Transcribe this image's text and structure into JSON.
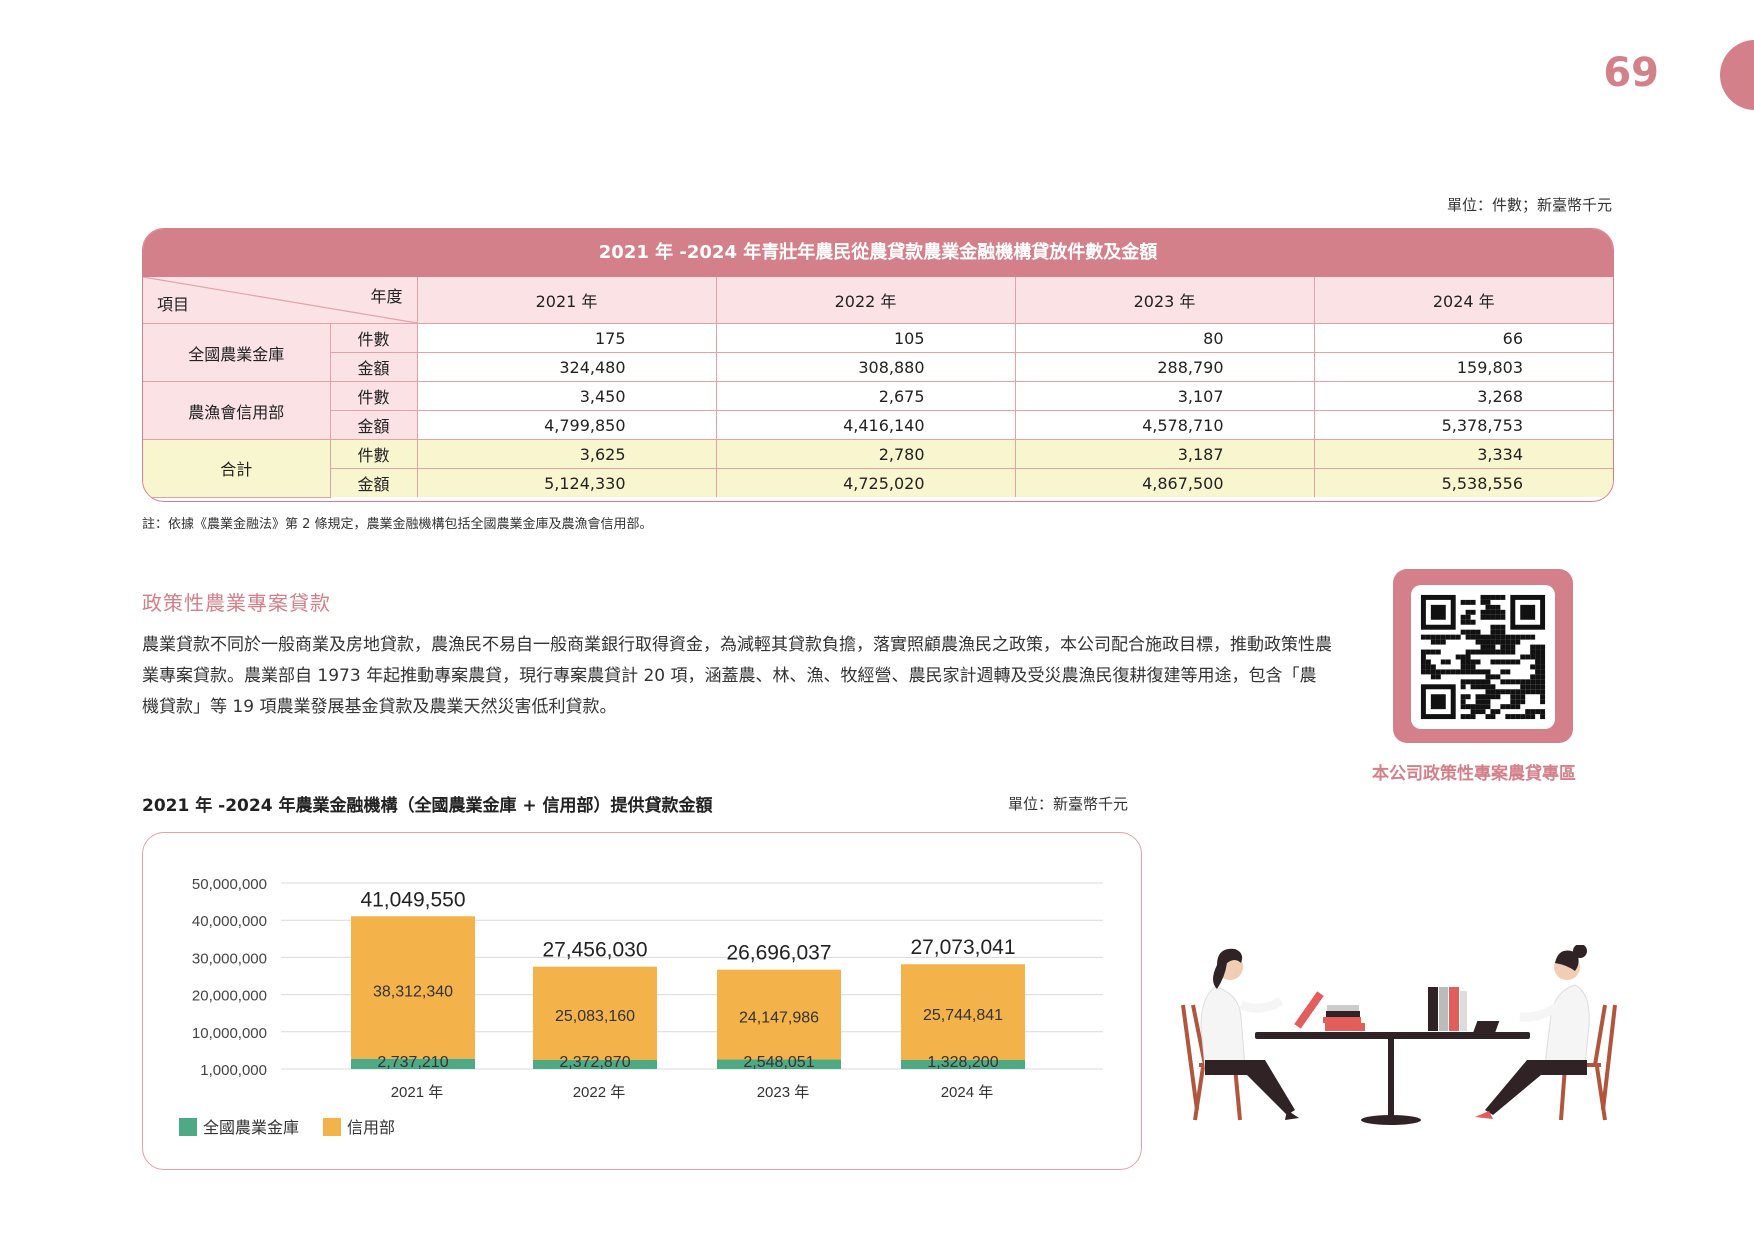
{
  "page_number": "69",
  "table": {
    "unit": "單位：件數；新臺幣千元",
    "title": "2021 年 -2024 年青壯年農民從農貸款農業金融機構貸放件數及金額",
    "header_item": "項目",
    "header_year": "年度",
    "years": [
      "2021 年",
      "2022 年",
      "2023 年",
      "2024 年"
    ],
    "groups": [
      {
        "name": "全國農業金庫",
        "rows": [
          {
            "metric": "件數",
            "values": [
              "175",
              "105",
              "80",
              "66"
            ]
          },
          {
            "metric": "金額",
            "values": [
              "324,480",
              "308,880",
              "288,790",
              "159,803"
            ]
          }
        ]
      },
      {
        "name": "農漁會信用部",
        "rows": [
          {
            "metric": "件數",
            "values": [
              "3,450",
              "2,675",
              "3,107",
              "3,268"
            ]
          },
          {
            "metric": "金額",
            "values": [
              "4,799,850",
              "4,416,140",
              "4,578,710",
              "5,378,753"
            ]
          }
        ]
      },
      {
        "name": "合計",
        "rows": [
          {
            "metric": "件數",
            "values": [
              "3,625",
              "2,780",
              "3,187",
              "3,334"
            ]
          },
          {
            "metric": "金額",
            "values": [
              "5,124,330",
              "4,725,020",
              "4,867,500",
              "5,538,556"
            ]
          }
        ]
      }
    ],
    "note": "註：依據《農業金融法》第 2 條規定，農業金融機構包括全國農業金庫及農漁會信用部。"
  },
  "section": {
    "title": "政策性農業專案貸款",
    "body": "農業貸款不同於一般商業及房地貸款，農漁民不易自一般商業銀行取得資金，為減輕其貸款負擔，落實照顧農漁民之政策，本公司配合施政目標，推動政策性農業專案貸款。農業部自 1973 年起推動專案農貸，現行專案農貸計 20 項，涵蓋農、林、漁、牧經營、農民家計週轉及受災農漁民復耕復建等用途，包含「農機貸款」等 19 項農業發展基金貸款及農業天然災害低利貸款。"
  },
  "qr": {
    "caption": "本公司政策性專案農貸專區"
  },
  "chart_data": {
    "type": "bar",
    "title": "2021 年 -2024 年農業金融機構（全國農業金庫 + 信用部）提供貸款金額",
    "unit": "單位：新臺幣千元",
    "categories": [
      "2021 年",
      "2022 年",
      "2023 年",
      "2024 年"
    ],
    "stacked": true,
    "series": [
      {
        "name": "全國農業金庫",
        "color": "#4daa84",
        "values": [
          2737210,
          2372870,
          2548051,
          1328200
        ],
        "labels": [
          "2,737,210",
          "2,372,870",
          "2,548,051",
          "1,328,200"
        ]
      },
      {
        "name": "信用部",
        "color": "#f3b24a",
        "values": [
          38312340,
          25083160,
          24147986,
          25744841
        ],
        "labels": [
          "38,312,340",
          "25,083,160",
          "24,147,986",
          "25,744,841"
        ]
      }
    ],
    "totals": [
      41049550,
      27456030,
      26696037,
      27073041
    ],
    "total_labels": [
      "41,049,550",
      "27,456,030",
      "26,696,037",
      "27,073,041"
    ],
    "y_ticks": [
      1000000,
      10000000,
      20000000,
      30000000,
      40000000,
      50000000
    ],
    "y_tick_labels": [
      "1,000,000",
      "10,000,000",
      "20,000,000",
      "30,000,000",
      "40,000,000",
      "50,000,000"
    ],
    "ylim": [
      0,
      50000000
    ],
    "grid": true,
    "legend": "bottom-left"
  }
}
